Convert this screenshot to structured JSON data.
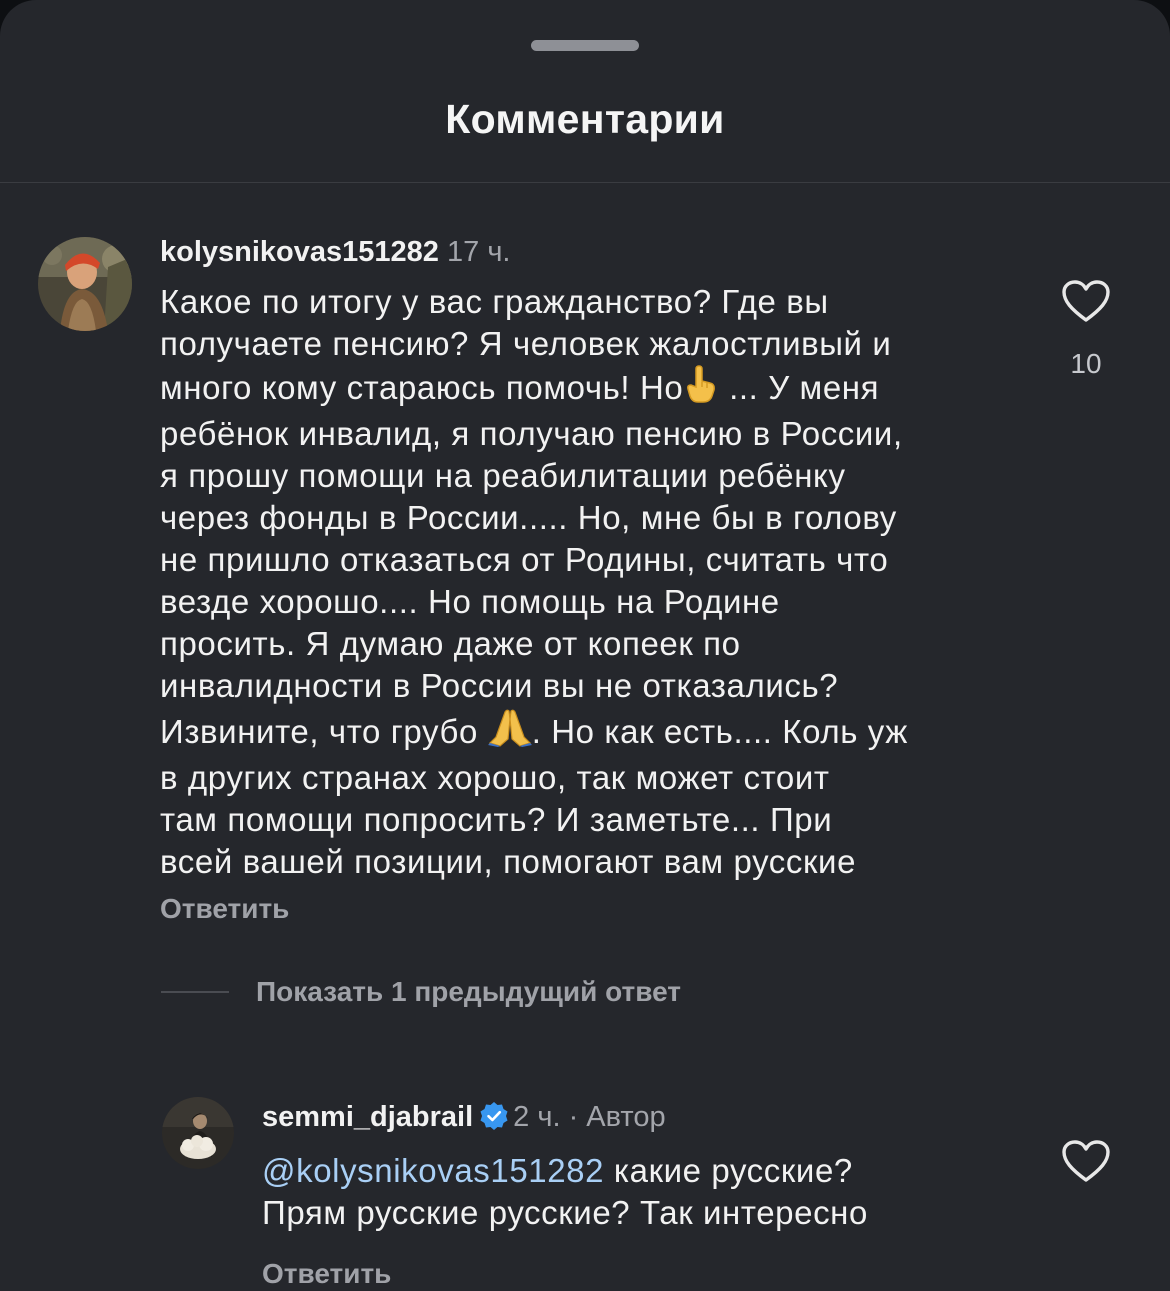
{
  "sheet": {
    "title": "Комментарии"
  },
  "comments": [
    {
      "username": "kolysnikovas151282",
      "time": "17 ч.",
      "lines": [
        "Какое по итогу у вас гражданство? Где вы",
        "получаете пенсию? Я человек жалостливый и",
        [
          "много кому стараюсь помочь! Но",
          " ... У меня"
        ],
        "ребёнок инвалид, я получаю пенсию в России,",
        "я прошу помощи на реабилитации ребёнку",
        "через фонды в России..... Но, мне бы в голову",
        "не пришло отказаться от Родины, считать что",
        "везде хорошо.... Но помощь на Родине",
        "просить. Я думаю даже от копеек по",
        "инвалидности в России вы не отказались?",
        [
          "Извините, что грубо ",
          ". Но как есть.... Коль уж"
        ],
        "в других странах хорошо, так может стоит",
        "там помощи попросить? И заметьте... При",
        "всей вашей позиции, помогают вам русские"
      ],
      "emoji_1": "👆",
      "emoji_2": "🙏",
      "likes": "10",
      "reply_label": "Ответить"
    },
    {
      "username": "semmi_djabrail",
      "time": "2 ч.",
      "author_badge": "· Автор",
      "mention": "@kolysnikovas151282",
      "line1_rest": " какие русские?",
      "line2": "Прям русские русские? Так интересно",
      "reply_label": "Ответить"
    }
  ],
  "show_more_label": "Показать 1 предыдущий ответ",
  "colors": {
    "background": "#25272c",
    "mention": "#a9cff5",
    "verified": "#3897f0",
    "secondary_text": "#a0a2a8"
  },
  "icons": [
    "heart-outline-icon",
    "verified-badge-icon",
    "pointing-up-emoji",
    "praying-hands-emoji"
  ]
}
